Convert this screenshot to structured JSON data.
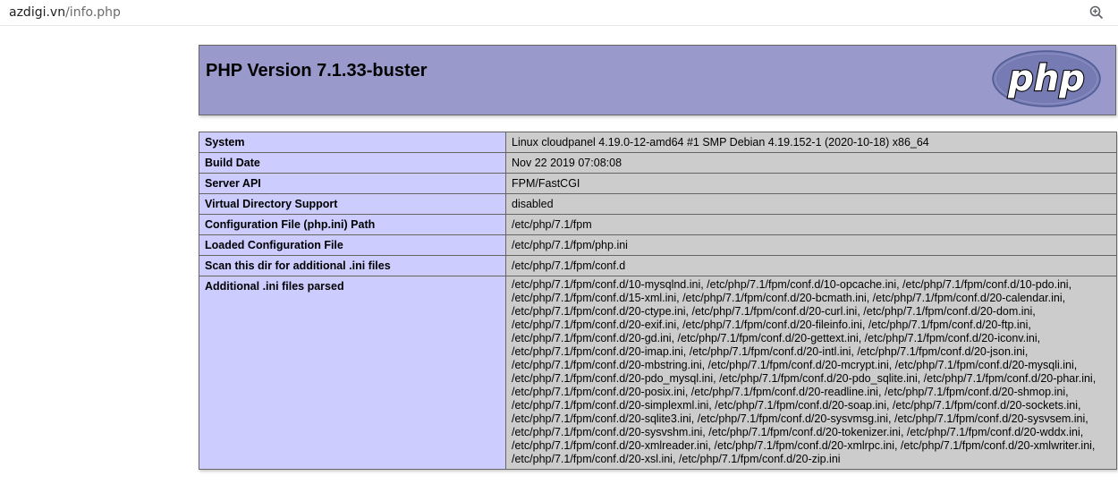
{
  "browser": {
    "url_host": "azdigi.vn",
    "url_path": "/info.php",
    "zoom_icon": "zoom-in-icon"
  },
  "header": {
    "title": "PHP Version 7.1.33-buster",
    "logo_text": "php"
  },
  "rows": [
    {
      "key": "System",
      "value": "Linux cloudpanel 4.19.0-12-amd64 #1 SMP Debian 4.19.152-1 (2020-10-18) x86_64"
    },
    {
      "key": "Build Date",
      "value": "Nov 22 2019 07:08:08"
    },
    {
      "key": "Server API",
      "value": "FPM/FastCGI"
    },
    {
      "key": "Virtual Directory Support",
      "value": "disabled"
    },
    {
      "key": "Configuration File (php.ini) Path",
      "value": "/etc/php/7.1/fpm"
    },
    {
      "key": "Loaded Configuration File",
      "value": "/etc/php/7.1/fpm/php.ini"
    },
    {
      "key": "Scan this dir for additional .ini files",
      "value": "/etc/php/7.1/fpm/conf.d"
    },
    {
      "key": "Additional .ini files parsed",
      "value": "/etc/php/7.1/fpm/conf.d/10-mysqlnd.ini, /etc/php/7.1/fpm/conf.d/10-opcache.ini, /etc/php/7.1/fpm/conf.d/10-pdo.ini, /etc/php/7.1/fpm/conf.d/15-xml.ini, /etc/php/7.1/fpm/conf.d/20-bcmath.ini, /etc/php/7.1/fpm/conf.d/20-calendar.ini, /etc/php/7.1/fpm/conf.d/20-ctype.ini, /etc/php/7.1/fpm/conf.d/20-curl.ini, /etc/php/7.1/fpm/conf.d/20-dom.ini, /etc/php/7.1/fpm/conf.d/20-exif.ini, /etc/php/7.1/fpm/conf.d/20-fileinfo.ini, /etc/php/7.1/fpm/conf.d/20-ftp.ini, /etc/php/7.1/fpm/conf.d/20-gd.ini, /etc/php/7.1/fpm/conf.d/20-gettext.ini, /etc/php/7.1/fpm/conf.d/20-iconv.ini, /etc/php/7.1/fpm/conf.d/20-imap.ini, /etc/php/7.1/fpm/conf.d/20-intl.ini, /etc/php/7.1/fpm/conf.d/20-json.ini, /etc/php/7.1/fpm/conf.d/20-mbstring.ini, /etc/php/7.1/fpm/conf.d/20-mcrypt.ini, /etc/php/7.1/fpm/conf.d/20-mysqli.ini, /etc/php/7.1/fpm/conf.d/20-pdo_mysql.ini, /etc/php/7.1/fpm/conf.d/20-pdo_sqlite.ini, /etc/php/7.1/fpm/conf.d/20-phar.ini, /etc/php/7.1/fpm/conf.d/20-posix.ini, /etc/php/7.1/fpm/conf.d/20-readline.ini, /etc/php/7.1/fpm/conf.d/20-shmop.ini, /etc/php/7.1/fpm/conf.d/20-simplexml.ini, /etc/php/7.1/fpm/conf.d/20-soap.ini, /etc/php/7.1/fpm/conf.d/20-sockets.ini, /etc/php/7.1/fpm/conf.d/20-sqlite3.ini, /etc/php/7.1/fpm/conf.d/20-sysvmsg.ini, /etc/php/7.1/fpm/conf.d/20-sysvsem.ini, /etc/php/7.1/fpm/conf.d/20-sysvshm.ini, /etc/php/7.1/fpm/conf.d/20-tokenizer.ini, /etc/php/7.1/fpm/conf.d/20-wddx.ini, /etc/php/7.1/fpm/conf.d/20-xmlreader.ini, /etc/php/7.1/fpm/conf.d/20-xmlrpc.ini, /etc/php/7.1/fpm/conf.d/20-xmlwriter.ini, /etc/php/7.1/fpm/conf.d/20-xsl.ini, /etc/php/7.1/fpm/conf.d/20-zip.ini"
    }
  ],
  "colors": {
    "header_bg": "#9999cc",
    "key_bg": "#ccccff",
    "value_bg": "#cccccc",
    "logo_fill": "#777bb3"
  }
}
